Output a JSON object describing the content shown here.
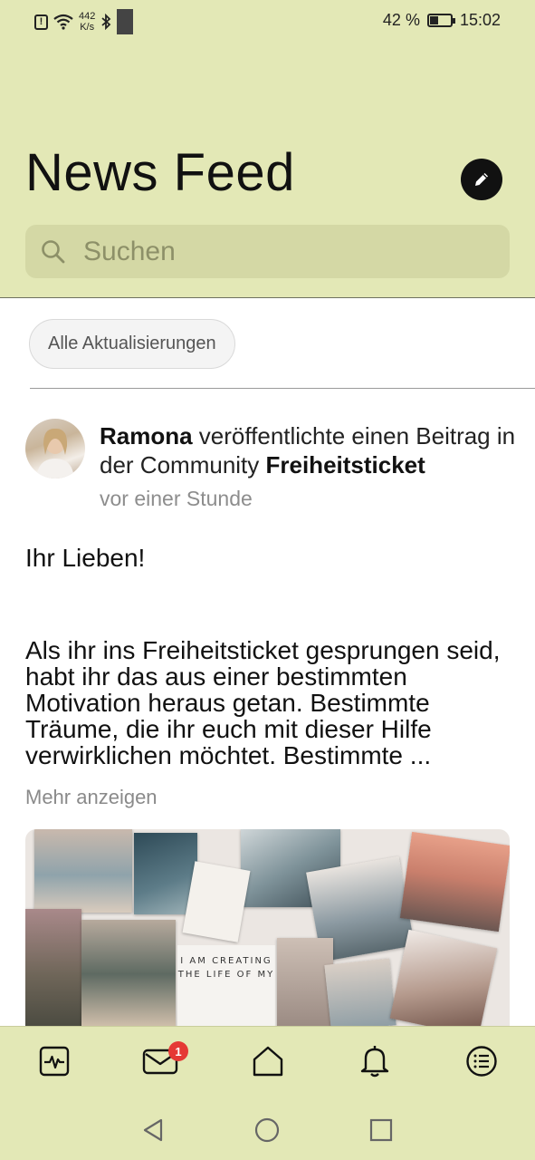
{
  "status_bar": {
    "speed_value": "442",
    "speed_unit": "K/s",
    "battery_percent": "42 %",
    "battery_level": 0.42,
    "time": "15:02"
  },
  "header": {
    "title": "News Feed",
    "search_placeholder": "Suchen"
  },
  "filter": {
    "chip_label": "Alle Aktualisierungen"
  },
  "post": {
    "author": "Ramona",
    "action_text": " veröffentlichte einen Beitrag in der Community ",
    "community": "Freiheitsticket",
    "time": "vor einer Stunde",
    "greeting": "Ihr Lieben!",
    "body": "Als ihr ins Freiheitsticket gesprungen seid, habt ihr das aus einer bestimmten Motivation heraus getan. Bestimmte Träume, die ihr euch mit dieser Hilfe verwirklichen möchtet. Bestimmte ...",
    "more_label": "Mehr anzeigen",
    "image_quote": "I AM CREATING THE LIFE OF MY"
  },
  "tabbar": {
    "items": [
      "activity-icon",
      "mail-icon",
      "home-icon",
      "bell-icon",
      "menu-list-icon"
    ],
    "mail_badge": "1"
  },
  "colors": {
    "header_bg": "#e3e8b6",
    "search_bg": "#d4d8a5",
    "badge": "#e53935"
  }
}
